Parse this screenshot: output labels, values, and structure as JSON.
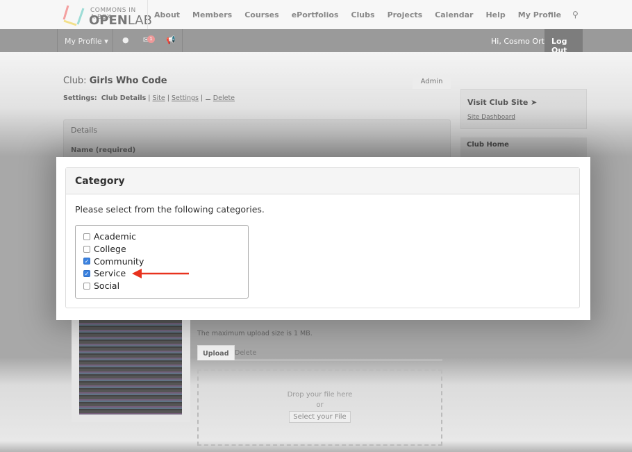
{
  "header": {
    "logo_top": "COMMONS IN A BOX",
    "logo_bold": "OPEN",
    "logo_light": "LAB",
    "nav": [
      "About",
      "Members",
      "Courses",
      "ePortfolios",
      "Clubs",
      "Projects",
      "Calendar",
      "Help",
      "My Profile"
    ],
    "search_icon": "search-icon"
  },
  "adminbar": {
    "my_profile": "My Profile",
    "notification_count": "1",
    "greeting": "Hi, Cosmo Ortiz",
    "logout": "Log Out"
  },
  "page": {
    "title_prefix": "Club:",
    "title": "Girls Who Code",
    "admin_tab": "Admin",
    "settings_label": "Settings:",
    "current": "Club Details",
    "links": [
      "Site",
      "Settings",
      "Delete"
    ],
    "details_heading": "Details",
    "name_label": "Name (required)"
  },
  "sidebar": {
    "visit": "Visit Club Site",
    "dashboard": "Site Dashboard",
    "club_home": "Club Home"
  },
  "modal": {
    "heading": "Category",
    "description": "Please select from the following categories.",
    "options": [
      {
        "label": "Academic",
        "checked": false
      },
      {
        "label": "College",
        "checked": false
      },
      {
        "label": "Community",
        "checked": true
      },
      {
        "label": "Service",
        "checked": true
      },
      {
        "label": "Social",
        "checked": false
      }
    ],
    "arrow_color": "#e8321e"
  },
  "upload": {
    "max_size": "The maximum upload size is 1 MB.",
    "tab_upload": "Upload",
    "tab_delete": "Delete",
    "drop_text": "Drop your file here",
    "or": "or",
    "select_button": "Select your File"
  }
}
